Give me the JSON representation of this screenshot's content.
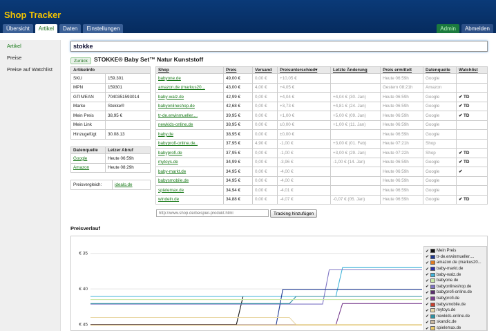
{
  "app": {
    "title": "Shop Tracker"
  },
  "tabs": [
    {
      "label": "Übersicht",
      "active": false
    },
    {
      "label": "Artikel",
      "active": true
    },
    {
      "label": "Daten",
      "active": false
    },
    {
      "label": "Einstellungen",
      "active": false
    }
  ],
  "header_right": {
    "admin": "Admin",
    "logout": "Abmelden"
  },
  "sidebar": {
    "items": [
      {
        "label": "Artikel",
        "active": true
      },
      {
        "label": "Preise",
        "active": false
      },
      {
        "label": "Preise auf Watchlist",
        "active": false
      }
    ]
  },
  "search": {
    "value": "stokke"
  },
  "product": {
    "back_label": "Zurück",
    "title": "STOKKE® Baby Set™ Natur Kunststoff"
  },
  "articleinfo": {
    "header": "Artikelinfo",
    "rows": [
      {
        "label": "SKU",
        "value": "159.301"
      },
      {
        "label": "MPN",
        "value": "159301"
      },
      {
        "label": "GTIN/EAN",
        "value": "7040351593014"
      },
      {
        "label": "Marke",
        "value": "Stokke®"
      },
      {
        "label": "Mein Preis",
        "value": "38,95 €"
      },
      {
        "label": "Mein Link",
        "value": ""
      },
      {
        "label": "Hinzugefügt",
        "value": "30.08.13"
      }
    ]
  },
  "datasource": {
    "headers": [
      "Datenquelle",
      "Letzer Abruf"
    ],
    "rows": [
      {
        "source": "Google",
        "time": "Heute 06:59h"
      },
      {
        "source": "Amazon",
        "time": "Heute 08:29h"
      }
    ]
  },
  "compare": {
    "label": "Preisvergleich:",
    "link": "idealo.de"
  },
  "shops": {
    "headers": [
      "Shop",
      "Preis",
      "Versand",
      "Preisunterschied▾",
      "Letzte Änderung",
      "Preis ermittelt",
      "Datenquelle",
      "Watchlist"
    ],
    "rows": [
      {
        "shop": "babyone.de",
        "preis": "49,00 €",
        "versand": "0,00 €",
        "diff": "+10,05 €",
        "change": "",
        "ermittelt": "Heute 06:59h",
        "quelle": "Google",
        "watch": ""
      },
      {
        "shop": "amazon.de (markus20...",
        "preis": "43,00 €",
        "versand": "4,00 €",
        "diff": "+4,05 €",
        "change": "",
        "ermittelt": "Gestern 08:21h",
        "quelle": "Amazon",
        "watch": ""
      },
      {
        "shop": "baby-walz.de",
        "preis": "42,99 €",
        "versand": "0,00 €",
        "diff": "+4,04 €",
        "change": "+4,04 € (30. Jan)",
        "ermittelt": "Heute 06:59h",
        "quelle": "Google",
        "watch": "✔ TD"
      },
      {
        "shop": "babyonlineshop.de",
        "preis": "42,68 €",
        "versand": "0,00 €",
        "diff": "+3,73 €",
        "change": "+4,81 € (24. Jan)",
        "ermittelt": "Heute 06:59h",
        "quelle": "Google",
        "watch": "✔ TD"
      },
      {
        "shop": "tr-de.erwinmueller....",
        "preis": "39,95 €",
        "versand": "0,00 €",
        "diff": "+1,00 €",
        "change": "+5,00 € (09. Jan)",
        "ermittelt": "Heute 06:59h",
        "quelle": "Google",
        "watch": "✔ TD"
      },
      {
        "shop": "newkids-online.de",
        "preis": "38,95 €",
        "versand": "0,00 €",
        "diff": "±0,00 €",
        "change": "+1,00 € (11. Jan)",
        "ermittelt": "Heute 06:59h",
        "quelle": "Google",
        "watch": ""
      },
      {
        "shop": "baby.de",
        "preis": "38,95 €",
        "versand": "0,00 €",
        "diff": "±0,00 €",
        "change": "",
        "ermittelt": "Heute 06:59h",
        "quelle": "Google",
        "watch": ""
      },
      {
        "shop": "babyprofi-online.de..",
        "preis": "37,95 €",
        "versand": "4,90 €",
        "diff": "-1,00 €",
        "change": "+3,00 € (01. Feb)",
        "ermittelt": "Heute 07:21h",
        "quelle": "Shop",
        "watch": ""
      },
      {
        "shop": "babyprofi.de",
        "preis": "37,95 €",
        "versand": "0,00 €",
        "diff": "-1,00 €",
        "change": "+3,00 € (29. Jan)",
        "ermittelt": "Heute 07:22h",
        "quelle": "Shop",
        "watch": "✔ TD"
      },
      {
        "shop": "mytoys.de",
        "preis": "34,99 €",
        "versand": "0,00 €",
        "diff": "-3,96 €",
        "change": "-1,00 € (14. Jan)",
        "ermittelt": "Heute 06:59h",
        "quelle": "Google",
        "watch": "✔ TD"
      },
      {
        "shop": "baby-markt.de",
        "preis": "34,95 €",
        "versand": "0,00 €",
        "diff": "-4,00 €",
        "change": "",
        "ermittelt": "Heute 06:59h",
        "quelle": "Google",
        "watch": "✔"
      },
      {
        "shop": "babysmobile.de",
        "preis": "34,95 €",
        "versand": "0,00 €",
        "diff": "-4,00 €",
        "change": "",
        "ermittelt": "Heute 06:59h",
        "quelle": "Google",
        "watch": ""
      },
      {
        "shop": "spielemax.de",
        "preis": "34,94 €",
        "versand": "0,00 €",
        "diff": "-4,01 €",
        "change": "",
        "ermittelt": "Heute 06:59h",
        "quelle": "Google",
        "watch": ""
      },
      {
        "shop": "windeln.de",
        "preis": "34,88 €",
        "versand": "0,00 €",
        "diff": "-4,07 €",
        "change": "-0,07 € (05. Jan)",
        "ermittelt": "Heute 06:59h",
        "quelle": "Google",
        "watch": "✔ TD"
      }
    ]
  },
  "tracking": {
    "placeholder": "http://www.shop.de/beispiel-produkt.html",
    "button": "Tracking hinzufügen"
  },
  "chart": {
    "title": "Preisverlauf",
    "y_ticks": [
      "€ 45",
      "€ 40",
      "€ 35"
    ],
    "legend": [
      {
        "name": "Mein Preis",
        "color": "#111111"
      },
      {
        "name": "tr-de.erwinmueller....",
        "color": "#1f3a93"
      },
      {
        "name": "amazon.de (markus20...",
        "color": "#e07b22"
      },
      {
        "name": "baby-markt.de",
        "color": "#2a2fa8"
      },
      {
        "name": "baby-walz.de",
        "color": "#3fb3d9"
      },
      {
        "name": "babyone.de",
        "color": "#c9e7a6"
      },
      {
        "name": "babyonlineshop.de",
        "color": "#7e74c4"
      },
      {
        "name": "babyprofi-online.de",
        "color": "#5a2e6e"
      },
      {
        "name": "babyprofi.de",
        "color": "#7a3f8f"
      },
      {
        "name": "babysmobile.de",
        "color": "#c8402f"
      },
      {
        "name": "mytoys.de",
        "color": "#e9d8a6"
      },
      {
        "name": "newkids-online.de",
        "color": "#2f8fa0"
      },
      {
        "name": "skandic.de",
        "color": "#c8b8a0"
      },
      {
        "name": "spielemax.de",
        "color": "#e8c86a"
      }
    ]
  },
  "chart_data": {
    "type": "line",
    "title": "Preisverlauf",
    "ylabel": "",
    "xlabel": "",
    "ylim": [
      34,
      47
    ],
    "y_ticks": [
      35,
      40,
      45
    ],
    "grid": true,
    "legend_position": "right",
    "series": [
      {
        "name": "Mein Preis",
        "color": "#111111",
        "x": [
          0,
          0.44,
          0.46,
          1
        ],
        "values": [
          35,
          35,
          38.95,
          38.95
        ]
      },
      {
        "name": "baby-walz.de",
        "color": "#3fb3d9",
        "x": [
          0,
          0.74,
          0.76,
          1
        ],
        "values": [
          38.95,
          38.95,
          42.99,
          42.99
        ]
      },
      {
        "name": "babyonlineshop.de",
        "color": "#7e74c4",
        "x": [
          0,
          0.7,
          0.72,
          1
        ],
        "values": [
          37.87,
          37.87,
          42.68,
          42.68
        ]
      },
      {
        "name": "tr-de.erwinmueller....",
        "color": "#1f3a93",
        "x": [
          0,
          0.56,
          0.58,
          1
        ],
        "values": [
          34.95,
          34.95,
          39.95,
          39.95
        ]
      },
      {
        "name": "babyprofi.de",
        "color": "#7a3f8f",
        "x": [
          0,
          0.74,
          0.76,
          1
        ],
        "values": [
          34.95,
          34.95,
          37.95,
          37.95
        ]
      },
      {
        "name": "newkids-online.de",
        "color": "#2f8fa0",
        "x": [
          0,
          0.6,
          0.62,
          1
        ],
        "values": [
          37.95,
          37.95,
          38.95,
          38.95
        ]
      },
      {
        "name": "mytoys.de",
        "color": "#e9d8a6",
        "x": [
          0,
          0.6,
          0.62,
          1
        ],
        "values": [
          35.99,
          35.99,
          34.99,
          34.99
        ]
      },
      {
        "name": "spielemax.de",
        "color": "#e8c86a",
        "x": [
          0,
          1
        ],
        "values": [
          34.94,
          34.94
        ]
      },
      {
        "name": "babyone.de",
        "color": "#c9e7a6",
        "x": [
          0,
          1
        ],
        "values": [
          38.5,
          38.5
        ]
      }
    ]
  }
}
